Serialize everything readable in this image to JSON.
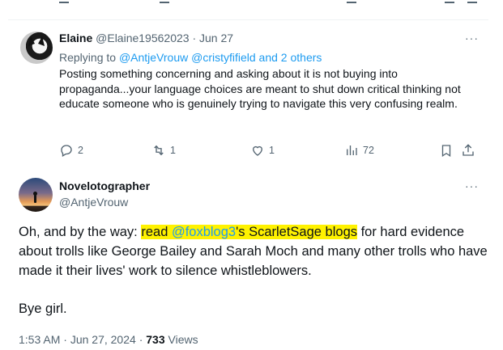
{
  "reply_tweet": {
    "author_name": "Elaine",
    "author_handle": "@Elaine19562023",
    "separator": "·",
    "date": "Jun 27",
    "more_label": "···",
    "replying_to_label": "Replying to",
    "replying_to_users": "@AntjeVrouw @cristyfifield and 2 others",
    "body": "Posting something concerning and asking about it is not buying into propaganda...your language choices are meant to shut down critical thinking not educate someone who is genuinely trying to navigate this very confusing realm.",
    "replies_count": "2",
    "reposts_count": "1",
    "likes_count": "1",
    "views_count": "72",
    "icons": [
      "avatar",
      "reply-icon",
      "repost-icon",
      "like-icon",
      "views-icon",
      "bookmark-icon",
      "share-icon"
    ]
  },
  "main_tweet": {
    "author_name": "Novelotographer",
    "author_handle": "@AntjeVrouw",
    "more_label": "···",
    "text_pre": "Oh, and by the way: ",
    "text_highlight_1": "read ",
    "mention": "@foxblog3",
    "text_highlight_2": "'s ScarletSage blogs",
    "text_post": " for hard evidence about trolls like George Bailey and Sarah Moch and many other trolls who have made it their lives' work to silence whistleblowers.",
    "closing": "Bye girl.",
    "time": "1:53 AM",
    "separator": "·",
    "date": "Jun 27, 2024",
    "separator2": "·",
    "views_count": "733",
    "views_label": "Views",
    "highlight_color": "#fff200",
    "link_color": "#1d9bf0"
  }
}
